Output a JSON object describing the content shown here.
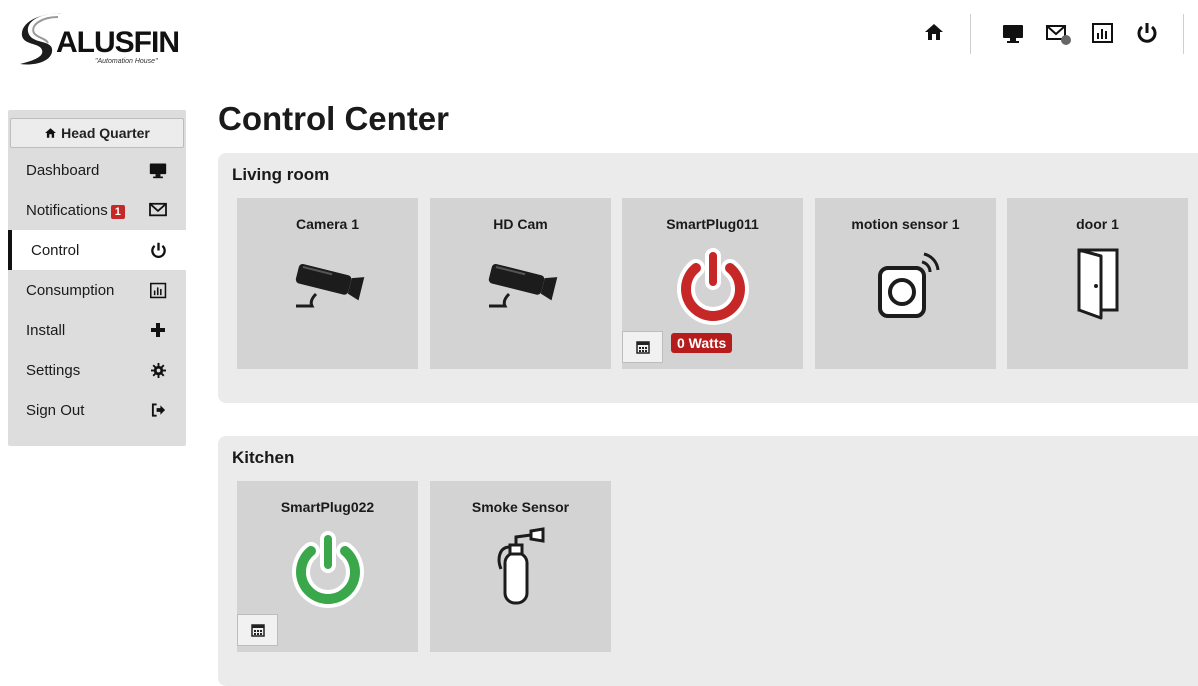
{
  "logo": {
    "name": "SALUSFIN",
    "name_suffix": "ALUSFIN",
    "tagline": "\"Automation House\""
  },
  "topbar": {
    "icons": [
      "home-icon",
      "monitor-icon",
      "mail-icon",
      "chart-icon",
      "power-icon"
    ]
  },
  "sidebar": {
    "header": "Head Quarter",
    "items": [
      {
        "label": "Dashboard",
        "icon": "monitor-icon"
      },
      {
        "label": "Notifications",
        "icon": "mail-icon",
        "badge": "1"
      },
      {
        "label": "Control",
        "icon": "power-icon",
        "active": true
      },
      {
        "label": "Consumption",
        "icon": "chart-icon"
      },
      {
        "label": "Install",
        "icon": "plus-icon"
      },
      {
        "label": "Settings",
        "icon": "gear-icon"
      },
      {
        "label": "Sign Out",
        "icon": "sign-out-icon"
      }
    ]
  },
  "page": {
    "title": "Control Center"
  },
  "rooms": [
    {
      "name": "Living room",
      "devices": [
        {
          "name": "Camera 1",
          "icon": "camera-icon"
        },
        {
          "name": "HD Cam",
          "icon": "camera-icon"
        },
        {
          "name": "SmartPlug011",
          "icon": "power-icon",
          "state_color": "#c62828",
          "watts": "0 Watts"
        },
        {
          "name": "motion sensor 1",
          "icon": "motion-sensor-icon"
        },
        {
          "name": "door 1",
          "icon": "door-icon"
        }
      ]
    },
    {
      "name": "Kitchen",
      "devices": [
        {
          "name": "SmartPlug022",
          "icon": "power-icon",
          "state_color": "#3aa84a"
        },
        {
          "name": "Smoke Sensor",
          "icon": "fire-extinguisher-icon"
        }
      ]
    }
  ],
  "colors": {
    "plug_off": "#c62828",
    "plug_on": "#3aa84a",
    "badge": "#c62828",
    "tile_bg": "#d3d3d3",
    "room_bg": "#ebebeb"
  }
}
